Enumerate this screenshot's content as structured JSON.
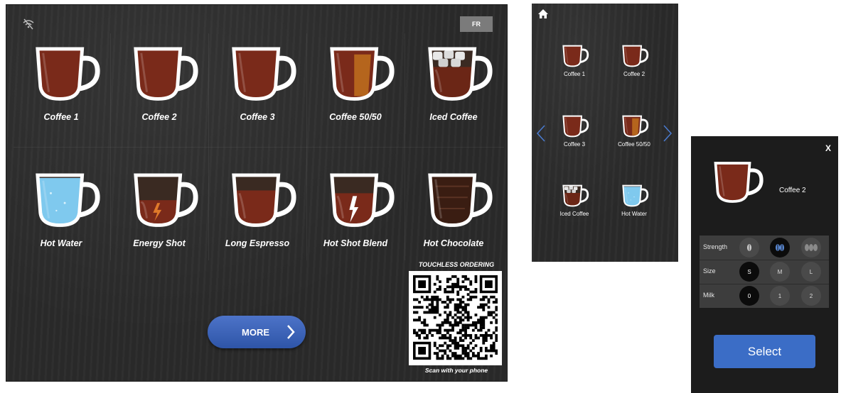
{
  "main": {
    "lang_button": "FR",
    "drinks": [
      {
        "label": "Coffee 1",
        "kind": "coffee"
      },
      {
        "label": "Coffee 2",
        "kind": "coffee"
      },
      {
        "label": "Coffee 3",
        "kind": "coffee"
      },
      {
        "label": "Coffee 50/50",
        "kind": "half"
      },
      {
        "label": "Iced Coffee",
        "kind": "iced"
      },
      {
        "label": "Hot Water",
        "kind": "water"
      },
      {
        "label": "Energy Shot",
        "kind": "energy"
      },
      {
        "label": "Long Espresso",
        "kind": "long"
      },
      {
        "label": "Hot Shot Blend",
        "kind": "blend"
      },
      {
        "label": "Hot Chocolate",
        "kind": "chocolate"
      }
    ],
    "more_button": "MORE",
    "qr_title": "TOUCHLESS ORDERING",
    "qr_caption": "Scan with your phone"
  },
  "mobile": {
    "drinks": [
      {
        "label": "Coffee 1",
        "kind": "coffee"
      },
      {
        "label": "Coffee 2",
        "kind": "coffee"
      },
      {
        "label": "Coffee 3",
        "kind": "coffee"
      },
      {
        "label": "Coffee 50/50",
        "kind": "half"
      },
      {
        "label": "Iced Coffee",
        "kind": "iced"
      },
      {
        "label": "Hot Water",
        "kind": "water"
      }
    ]
  },
  "detail": {
    "close_label": "X",
    "drink_name": "Coffee 2",
    "strength_label": "Strength",
    "size_label": "Size",
    "milk_label": "Milk",
    "strength_level_selected": 2,
    "size_options": [
      "S",
      "M",
      "L"
    ],
    "size_selected": "S",
    "milk_options": [
      "0",
      "1",
      "2"
    ],
    "milk_selected": "0",
    "select_button": "Select"
  },
  "colors": {
    "accent_blue": "#3b6dc6",
    "coffee": "#7a2a1a",
    "water": "#7fc9ee",
    "panel": "#2b2b2b"
  }
}
